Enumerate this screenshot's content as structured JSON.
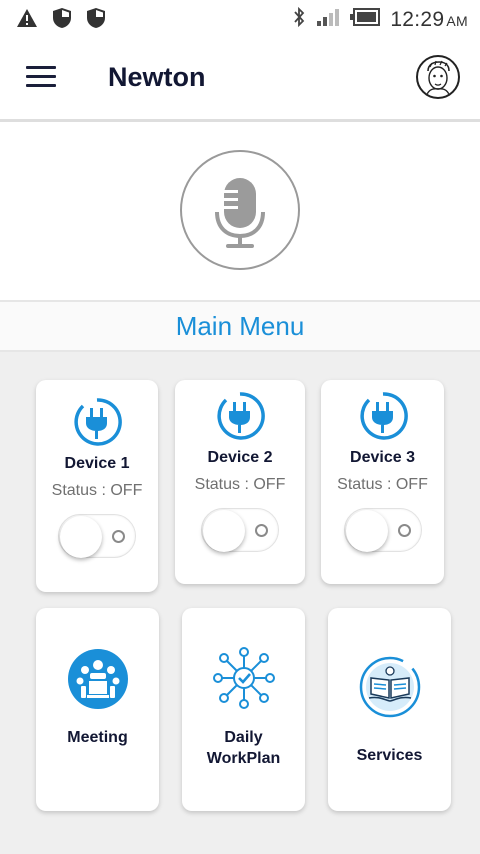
{
  "status_bar": {
    "time": "12:29",
    "ampm": "AM",
    "icons": [
      "warning-icon",
      "shield-icon",
      "shield-icon",
      "bluetooth-icon",
      "signal-icon",
      "battery-icon"
    ]
  },
  "app_bar": {
    "title": "Newton",
    "menu_icon": "hamburger-menu-icon",
    "avatar_icon": "avatar-sketch-icon"
  },
  "mic": {
    "icon": "microphone-icon"
  },
  "section": {
    "title": "Main Menu"
  },
  "devices": [
    {
      "name": "Device 1",
      "status": "Status : OFF",
      "icon": "plug-icon",
      "on": false
    },
    {
      "name": "Device 2",
      "status": "Status : OFF",
      "icon": "plug-icon",
      "on": false
    },
    {
      "name": "Device 3",
      "status": "Status : OFF",
      "icon": "plug-icon",
      "on": false
    }
  ],
  "menu_items": [
    {
      "label": "Meeting",
      "icon": "meeting-icon"
    },
    {
      "label_line1": "Daily",
      "label_line2": "WorkPlan",
      "icon": "workplan-network-icon"
    },
    {
      "label": "Services",
      "icon": "services-book-icon"
    }
  ],
  "colors": {
    "accent": "#1a8fd8",
    "title_text": "#121733",
    "status_text": "#707070",
    "grid_background": "#efefef"
  }
}
